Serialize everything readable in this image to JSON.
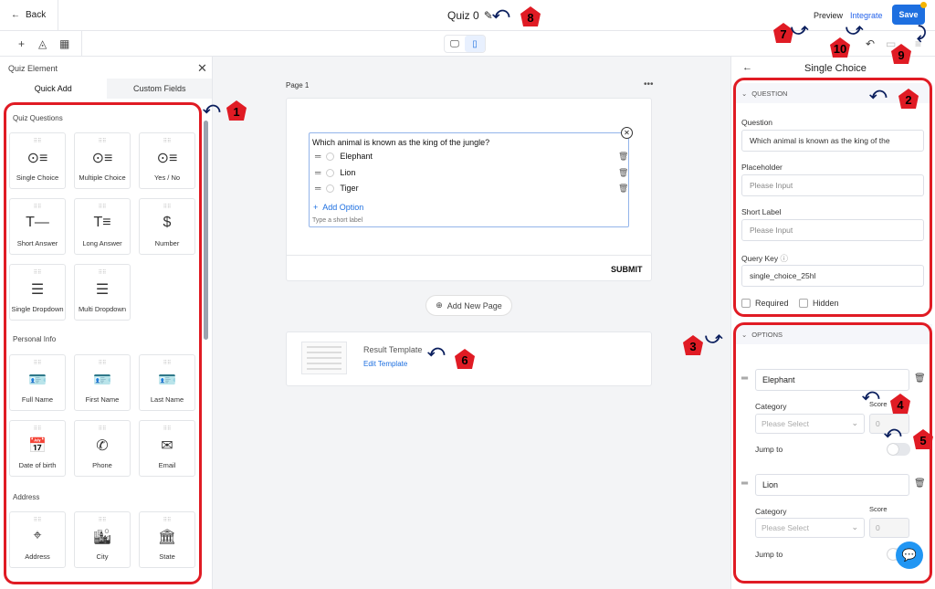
{
  "topbar": {
    "back_label": "Back",
    "quiz_title": "Quiz 0",
    "preview_label": "Preview",
    "integrate_label": "Integrate",
    "save_label": "Save"
  },
  "left_panel": {
    "title": "Quiz Element",
    "tabs": [
      "Quick Add",
      "Custom Fields"
    ],
    "sections": {
      "quiz_questions": "Quiz Questions",
      "personal_info": "Personal Info",
      "address": "Address"
    },
    "quiz_items": [
      {
        "label": "Single Choice",
        "icon": "single-choice-icon",
        "glyph": "⊙≡"
      },
      {
        "label": "Multiple Choice",
        "icon": "multiple-choice-icon",
        "glyph": "⊙≡"
      },
      {
        "label": "Yes / No",
        "icon": "yes-no-icon",
        "glyph": "⊙≡"
      },
      {
        "label": "Short Answer",
        "icon": "short-answer-icon",
        "glyph": "T—"
      },
      {
        "label": "Long Answer",
        "icon": "long-answer-icon",
        "glyph": "T≡"
      },
      {
        "label": "Number",
        "icon": "number-icon",
        "glyph": "$"
      },
      {
        "label": "Single Dropdown",
        "icon": "single-dropdown-icon",
        "glyph": "☰"
      },
      {
        "label": "Multi Dropdown",
        "icon": "multi-dropdown-icon",
        "glyph": "☰"
      }
    ],
    "personal_items": [
      {
        "label": "Full Name",
        "icon": "full-name-icon",
        "glyph": "🪪"
      },
      {
        "label": "First Name",
        "icon": "first-name-icon",
        "glyph": "🪪"
      },
      {
        "label": "Last Name",
        "icon": "last-name-icon",
        "glyph": "🪪"
      },
      {
        "label": "Date of birth",
        "icon": "calendar-icon",
        "glyph": "📅"
      },
      {
        "label": "Phone",
        "icon": "phone-icon",
        "glyph": "✆"
      },
      {
        "label": "Email",
        "icon": "email-icon",
        "glyph": "✉"
      }
    ],
    "address_items": [
      {
        "label": "Address",
        "icon": "location-icon",
        "glyph": "⌖"
      },
      {
        "label": "City",
        "icon": "city-icon",
        "glyph": "🏙"
      },
      {
        "label": "State",
        "icon": "state-icon",
        "glyph": "🏛"
      }
    ]
  },
  "canvas": {
    "page_label": "Page 1",
    "question_text": "Which animal is known as the king of the jungle?",
    "options": [
      "Elephant",
      "Lion",
      "Tiger"
    ],
    "add_option_label": "Add Option",
    "short_label_placeholder": "Type a short label",
    "submit_label": "SUBMIT",
    "add_page_label": "Add New Page",
    "result_title": "Result Template",
    "result_edit": "Edit Template"
  },
  "right_panel": {
    "title": "Single Choice",
    "question_section": "QUESTION",
    "question_label": "Question",
    "question_value": "Which animal is known as the king of the",
    "placeholder_label": "Placeholder",
    "placeholder_value": "Please Input",
    "short_label_label": "Short Label",
    "short_label_value": "Please Input",
    "query_key_label": "Query Key",
    "query_key_value": "single_choice_25hl",
    "required_label": "Required",
    "hidden_label": "Hidden",
    "options_section": "OPTIONS",
    "option_items": [
      {
        "value": "Elephant",
        "category_label": "Category",
        "category_placeholder": "Please Select",
        "score_label": "Score",
        "score_value": "0",
        "jump_label": "Jump to"
      },
      {
        "value": "Lion",
        "category_label": "Category",
        "category_placeholder": "Please Select",
        "score_label": "Score",
        "score_value": "0",
        "jump_label": "Jump to"
      }
    ]
  },
  "annotations": [
    "1",
    "2",
    "3",
    "4",
    "5",
    "6",
    "7",
    "8",
    "9",
    "10"
  ],
  "colors": {
    "accent": "#1d6fe0",
    "highlight": "#e01b24",
    "badge": "#e01b24"
  }
}
